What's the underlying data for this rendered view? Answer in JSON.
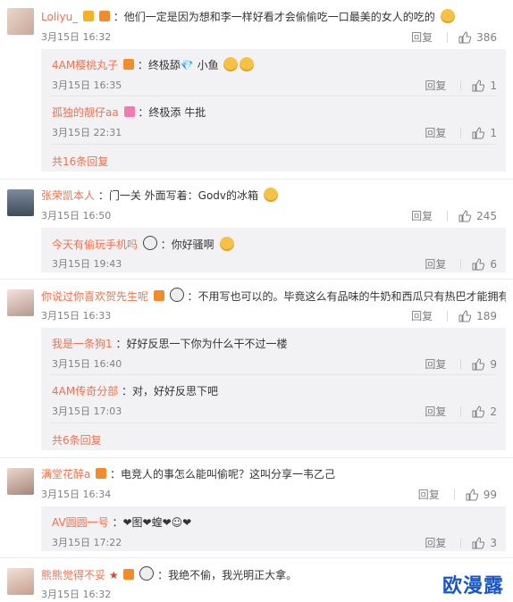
{
  "reply_label": "回复",
  "comments": [
    {
      "name": "Loliyu_",
      "text": "：他们一定是因为想和李一样好看才会偷偷吃一口最美的女人的吃的",
      "time": "3月15日 16:32",
      "likes": "386",
      "replies": [
        {
          "name": "4AM樱桃丸子",
          "text": "：终极舔💎 小鱼",
          "time": "3月15日 16:35",
          "likes": "1"
        },
        {
          "name": "孤独的靓仔aa",
          "text": "：终极添  牛批",
          "time": "3月15日 22:31",
          "likes": "1"
        }
      ],
      "more": "共16条回复"
    },
    {
      "name": "张荣凯本人",
      "text": "：门一关 外面写着：Godv的冰箱",
      "time": "3月15日 16:50",
      "likes": "245",
      "replies": [
        {
          "name": "今天有偷玩手机吗",
          "text": "：你好骚啊",
          "time": "3月15日 19:43",
          "likes": "6"
        }
      ]
    },
    {
      "name": "你说过你喜欢贺先生呢",
      "text": "：不用写也可以的。毕竟这么有品味的牛奶和西瓜只有热巴才能拥有",
      "time": "3月15日 16:33",
      "likes": "189",
      "replies": [
        {
          "name": "我是一条狗1",
          "text": "：好好反思一下你为什么干不过一楼",
          "time": "3月15日 16:40",
          "likes": "9"
        },
        {
          "name": "4AM传奇分部",
          "text": "：对，好好反思下吧",
          "time": "3月15日 17:03",
          "likes": "2"
        }
      ],
      "more": "共6条回复"
    },
    {
      "name": "满堂花醉a",
      "text": "：电竞人的事怎么能叫偷呢？这叫分享一韦乙己",
      "time": "3月15日 16:34",
      "likes": "99",
      "replies": [
        {
          "name": "AV圆圆一号",
          "text": "：❤图❤蝗❤☺❤",
          "time": "3月15日 17:22",
          "likes": "3"
        }
      ]
    },
    {
      "name": "熊熊觉得不妥",
      "text": "：我绝不偷，我光明正大拿。",
      "time": "3月15日 16:32",
      "likes": ""
    }
  ],
  "watermark": "欧漫露",
  "colors": {
    "link": "#eb7350",
    "reply_bg": "#f2f2f5",
    "watermark": "#1a57c5"
  }
}
